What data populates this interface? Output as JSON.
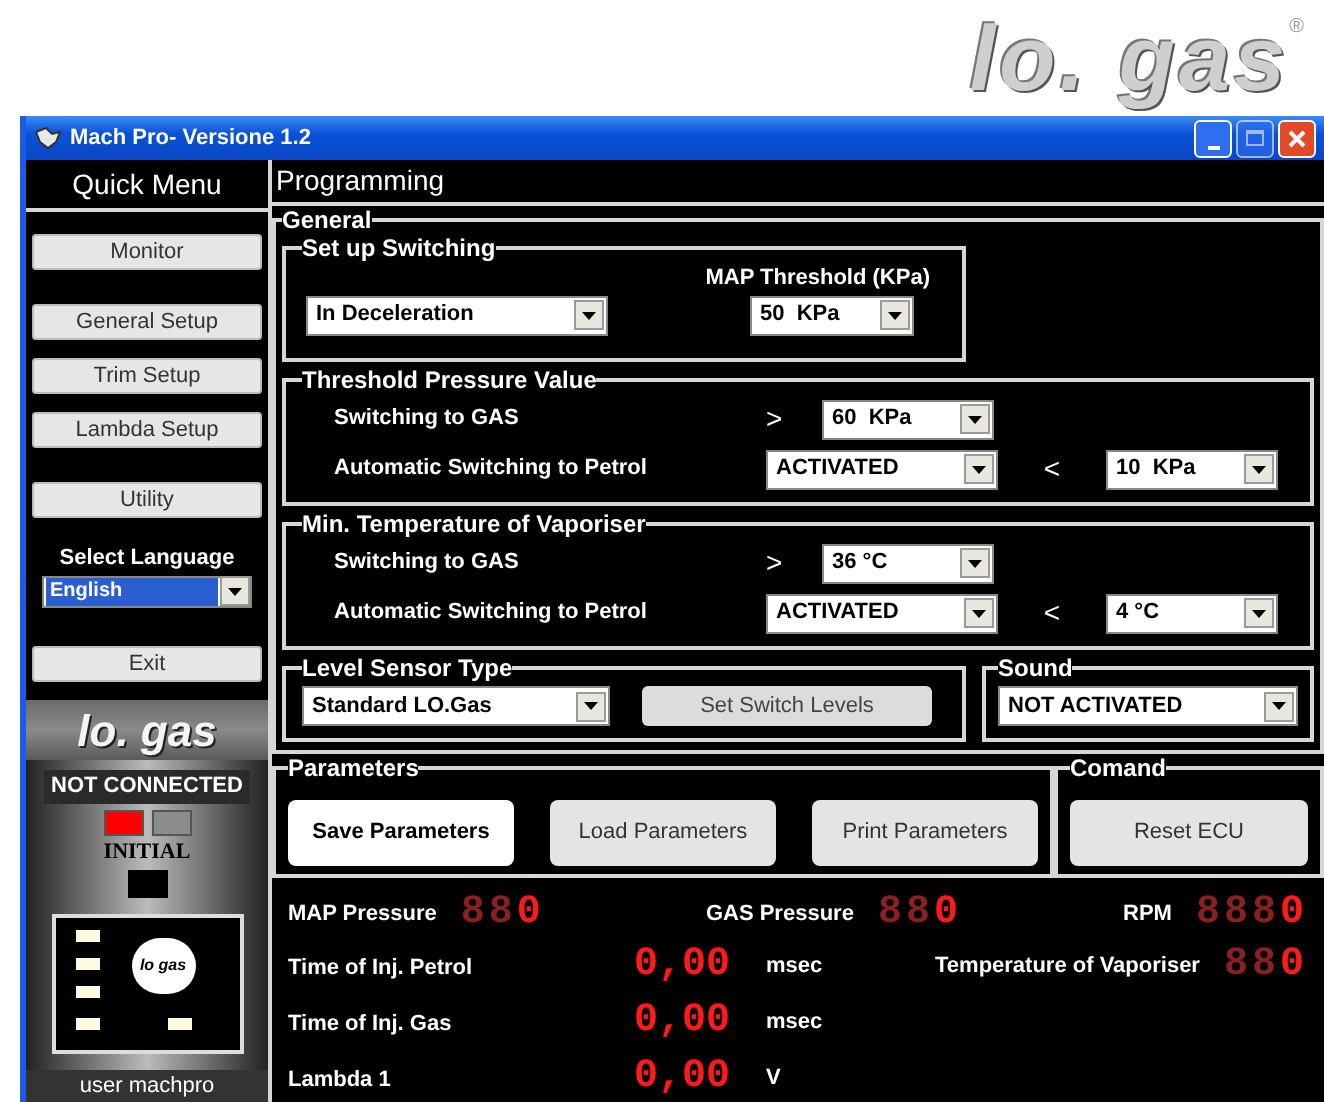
{
  "logo": {
    "text": "lo. gas",
    "mark": "®"
  },
  "window": {
    "title": "Mach Pro- Versione 1.2"
  },
  "sidebar": {
    "title": "Quick Menu",
    "menu_groups": [
      [
        "Monitor"
      ],
      [
        "General Setup",
        "Trim Setup",
        "Lambda Setup"
      ],
      [
        "Utility"
      ]
    ],
    "language_label": "Select Language",
    "language": "English",
    "exit": "Exit",
    "logo": "lo. gas",
    "status": "NOT CONNECTED",
    "indicators": [
      {
        "color": "#ff0000"
      },
      {
        "color": "#8c8c8c"
      }
    ],
    "mode": "INITIAL",
    "mode_indicator": {
      "color": "#000000"
    },
    "device_label": "lo gas",
    "user": "user machpro"
  },
  "main": {
    "title": "Programming",
    "general": {
      "title": "General",
      "set_up_switching": {
        "title": "Set up Switching",
        "mode": "In Deceleration",
        "map_threshold_label": "MAP Threshold (KPa)",
        "map_threshold": "50  KPa"
      },
      "sections": [
        {
          "title": "Threshold Pressure Value",
          "rows": [
            {
              "label": "Switching to GAS",
              "operator": ">",
              "value": "60  KPa"
            },
            {
              "label": "Automatic Switching to Petrol",
              "value": "ACTIVATED",
              "operator": "<",
              "limit": "10  KPa"
            }
          ]
        },
        {
          "title": "Min. Temperature of Vaporiser",
          "rows": [
            {
              "label": "Switching to GAS",
              "operator": ">",
              "value": "36 °C"
            },
            {
              "label": "Automatic Switching to Petrol",
              "value": "ACTIVATED",
              "operator": "<",
              "limit": "4 °C"
            }
          ]
        }
      ],
      "level_sensor": {
        "title": "Level Sensor Type",
        "type": "Standard LO.Gas",
        "button": "Set Switch Levels"
      },
      "sound": {
        "title": "Sound",
        "value": "NOT ACTIVATED"
      }
    },
    "parameters": {
      "title": "Parameters",
      "buttons": [
        {
          "label": "Save Parameters",
          "focused": true
        },
        {
          "label": "Load Parameters",
          "focused": false
        },
        {
          "label": "Print Parameters",
          "focused": false
        }
      ]
    },
    "command": {
      "title": "Comand",
      "button": {
        "label": "Reset ECU",
        "focused": false
      }
    },
    "readings": [
      {
        "kind": "counter",
        "label": "MAP Pressure",
        "unlit": "88",
        "value": "0"
      },
      {
        "kind": "counter",
        "label": "GAS Pressure",
        "unlit": "88",
        "value": "0"
      },
      {
        "kind": "counter",
        "label": "RPM",
        "unlit": "888",
        "value": "0"
      },
      {
        "kind": "decimal",
        "label": "Time of Inj. Petrol",
        "value": "0,00",
        "unit": "msec"
      },
      {
        "kind": "counter",
        "label": "Temperature of Vaporiser",
        "unlit": "88",
        "value": "0"
      },
      {
        "kind": "decimal",
        "label": "Time of Inj. Gas",
        "value": "0,00",
        "unit": "msec"
      },
      {
        "kind": "decimal",
        "label": "Lambda 1",
        "value": "0,00",
        "unit": "V"
      }
    ]
  }
}
